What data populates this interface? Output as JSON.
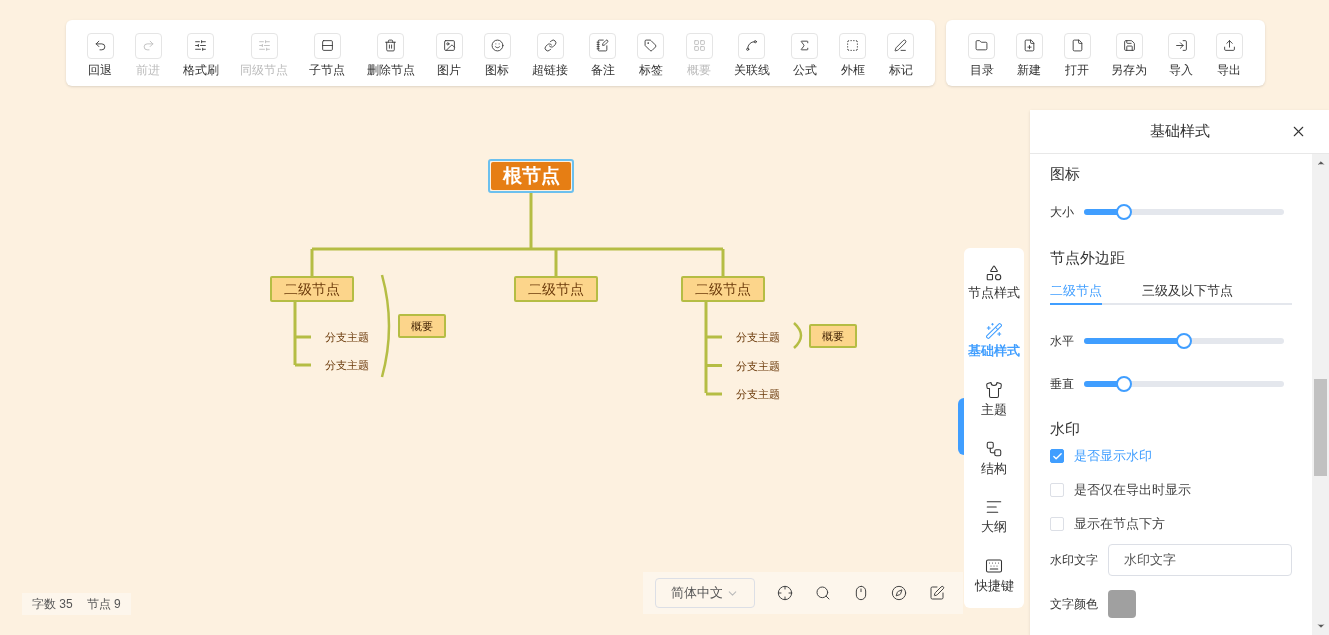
{
  "toolbar": [
    {
      "label": "回退",
      "disabled": false
    },
    {
      "label": "前进",
      "disabled": true
    },
    {
      "label": "格式刷",
      "disabled": false
    },
    {
      "label": "同级节点",
      "disabled": true
    },
    {
      "label": "子节点",
      "disabled": false
    },
    {
      "label": "删除节点",
      "disabled": false
    },
    {
      "label": "图片",
      "disabled": false
    },
    {
      "label": "图标",
      "disabled": false
    },
    {
      "label": "超链接",
      "disabled": false
    },
    {
      "label": "备注",
      "disabled": false
    },
    {
      "label": "标签",
      "disabled": false
    },
    {
      "label": "概要",
      "disabled": true
    },
    {
      "label": "关联线",
      "disabled": false
    },
    {
      "label": "公式",
      "disabled": false
    },
    {
      "label": "外框",
      "disabled": false
    },
    {
      "label": "标记",
      "disabled": false
    }
  ],
  "file_toolbar": [
    {
      "label": "目录"
    },
    {
      "label": "新建"
    },
    {
      "label": "打开"
    },
    {
      "label": "另存为"
    },
    {
      "label": "导入"
    },
    {
      "label": "导出"
    }
  ],
  "mindmap": {
    "root": {
      "text": "根节点",
      "selected": true,
      "children": [
        {
          "text": "二级节点",
          "summary": "概要",
          "children": [
            {
              "text": "分支主题"
            },
            {
              "text": "分支主题"
            }
          ]
        },
        {
          "text": "二级节点"
        },
        {
          "text": "二级节点",
          "summary": "概要",
          "children": [
            {
              "text": "分支主题"
            },
            {
              "text": "分支主题"
            },
            {
              "text": "分支主题"
            }
          ]
        }
      ]
    }
  },
  "side_nav": [
    {
      "label": "节点样式",
      "selected": false
    },
    {
      "label": "基础样式",
      "selected": true
    },
    {
      "label": "主题",
      "selected": false
    },
    {
      "label": "结构",
      "selected": false
    },
    {
      "label": "大纲",
      "selected": false
    },
    {
      "label": "快捷键",
      "selected": false
    }
  ],
  "panel": {
    "title": "基础样式",
    "icon_section": {
      "title": "图标",
      "sliders": [
        {
          "label": "大小",
          "level": 0.2
        }
      ]
    },
    "margin_section": {
      "title": "节点外边距",
      "tabs": [
        {
          "label": "二级节点",
          "selected": true
        },
        {
          "label": "三级及以下节点",
          "selected": false
        }
      ],
      "sliders": [
        {
          "label": "水平",
          "level": 0.5
        },
        {
          "label": "垂直",
          "level": 0.2
        }
      ]
    },
    "watermark_section": {
      "title": "水印",
      "options": [
        {
          "label": "是否显示水印",
          "checked": true
        },
        {
          "label": "是否仅在导出时显示",
          "checked": false
        },
        {
          "label": "显示在节点下方",
          "checked": false
        }
      ],
      "text_field": {
        "label": "水印文字",
        "value": "水印文字"
      },
      "color_field": {
        "label": "文字颜色",
        "color": "#a0a0a0"
      }
    }
  },
  "status": [
    {
      "label": "字数",
      "value": "35"
    },
    {
      "label": "节点",
      "value": "9"
    }
  ],
  "language": "简体中文"
}
